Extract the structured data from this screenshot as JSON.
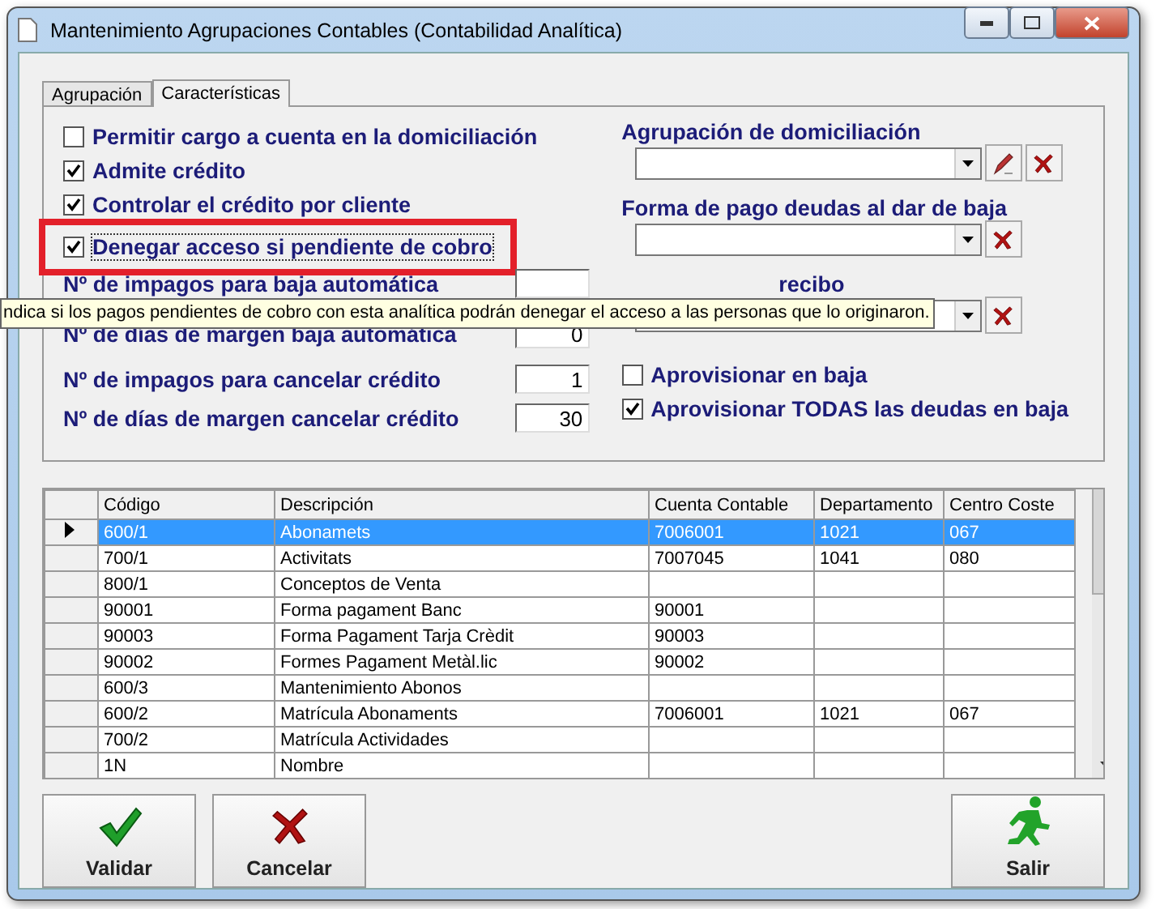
{
  "window": {
    "title": "Mantenimiento Agrupaciones Contables (Contabilidad Analítica)"
  },
  "tabs": [
    {
      "label": "Agrupación",
      "selected": false
    },
    {
      "label": "Características",
      "selected": true
    }
  ],
  "options_left": [
    {
      "label": "Permitir cargo a cuenta en la domiciliación",
      "checked": false,
      "focused": false,
      "highlighted": false
    },
    {
      "label": "Admite crédito",
      "checked": true,
      "focused": false,
      "highlighted": false
    },
    {
      "label": "Controlar el crédito por cliente",
      "checked": true,
      "focused": false,
      "highlighted": false
    },
    {
      "label": "Denegar acceso si pendiente de cobro",
      "checked": true,
      "focused": true,
      "highlighted": true
    }
  ],
  "numeric_fields": [
    {
      "label": "Nº de impagos para baja automática"
    },
    {
      "label": "Nº de días de margen baja automática",
      "value": "0"
    },
    {
      "label": "Nº de impagos para cancelar crédito",
      "value": "1"
    },
    {
      "label": "Nº de días de margen cancelar crédito",
      "value": "30"
    }
  ],
  "lookups": [
    {
      "label": "Agrupación de domiciliación",
      "edit_button": true
    },
    {
      "label": "Forma de pago deudas al dar de baja",
      "edit_button": false
    },
    {
      "label": "recibo",
      "edit_button": false
    }
  ],
  "options_right": [
    {
      "label": "Aprovisionar en baja",
      "checked": false
    },
    {
      "label": "Aprovisionar TODAS las deudas  en baja",
      "checked": true
    }
  ],
  "tooltip": "ndica si  los pagos pendientes de cobro con esta analítica podrán denegar el acceso a las personas que lo originaron.",
  "table": {
    "columns": [
      "Código",
      "Descripción",
      "Cuenta Contable",
      "Departamento",
      "Centro Coste"
    ],
    "rows": [
      {
        "selected": true,
        "cells": [
          "600/1",
          "Abonamets",
          "7006001",
          "1021",
          "067"
        ]
      },
      {
        "selected": false,
        "cells": [
          "700/1",
          "Activitats",
          "7007045",
          "1041",
          "080"
        ]
      },
      {
        "selected": false,
        "cells": [
          "800/1",
          "Conceptos de Venta",
          "",
          "",
          ""
        ]
      },
      {
        "selected": false,
        "cells": [
          "90001",
          "Forma pagament Banc",
          "90001",
          "",
          ""
        ]
      },
      {
        "selected": false,
        "cells": [
          "90003",
          "Forma Pagament Tarja Crèdit",
          "90003",
          "",
          ""
        ]
      },
      {
        "selected": false,
        "cells": [
          "90002",
          "Formes Pagament Metàl.lic",
          "90002",
          "",
          ""
        ]
      },
      {
        "selected": false,
        "cells": [
          "600/3",
          "Mantenimiento Abonos",
          "",
          "",
          ""
        ]
      },
      {
        "selected": false,
        "cells": [
          "600/2",
          "Matrícula Abonaments",
          "7006001",
          "1021",
          "067"
        ]
      },
      {
        "selected": false,
        "cells": [
          "700/2",
          "Matrícula Actividades",
          "",
          "",
          ""
        ]
      },
      {
        "selected": false,
        "cells": [
          "1N",
          "Nombre",
          "",
          "",
          ""
        ]
      }
    ]
  },
  "buttons": [
    {
      "kind": "validate",
      "label": "Validar"
    },
    {
      "kind": "cancel",
      "label": "Cancelar"
    },
    {
      "kind": "exit",
      "label": "Salir"
    }
  ]
}
